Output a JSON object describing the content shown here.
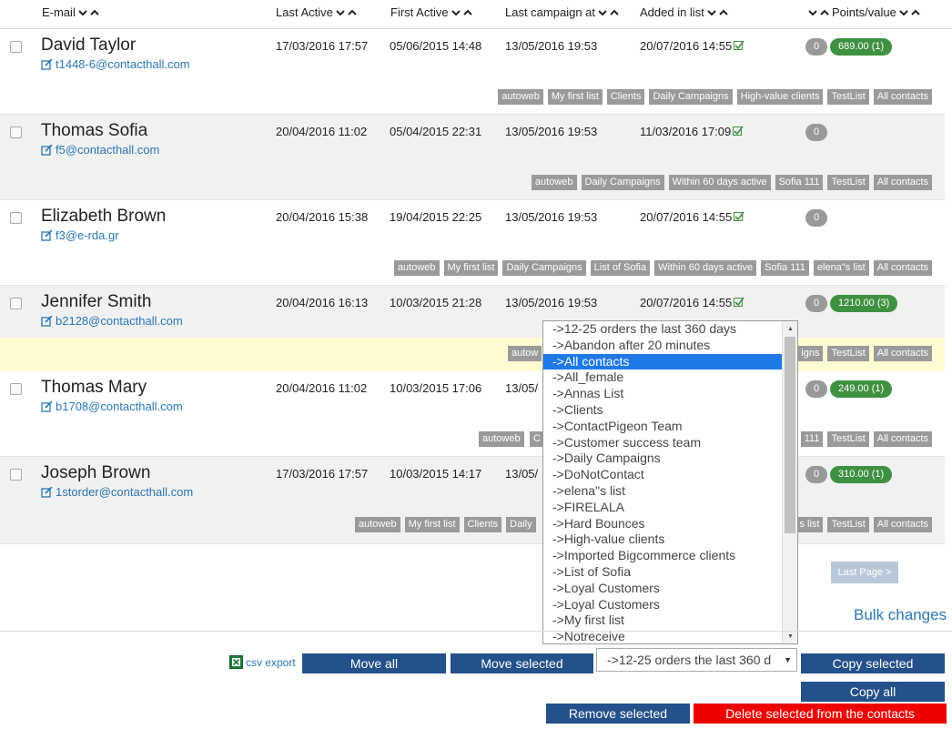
{
  "header": {
    "email": "E-mail",
    "last_active": "Last Active",
    "first_active": "First Active",
    "last_campaign": "Last campaign at",
    "added": "Added in list",
    "points": "Points/value"
  },
  "rows": [
    {
      "name": "David Taylor",
      "email": "t1448-6@contacthall.com",
      "last_active": "17/03/2016 17:57",
      "first_active": "05/06/2015 14:48",
      "last_campaign": "13/05/2016 19:53",
      "added": "20/07/2016 14:55",
      "points": "0",
      "value": "689.00 (1)",
      "tags": [
        "autoweb",
        "My first list",
        "Clients",
        "Daily Campaigns",
        "High-value clients",
        "TestList",
        "All contacts"
      ]
    },
    {
      "name": "Thomas Sofia",
      "email": "f5@contacthall.com",
      "last_active": "20/04/2016 11:02",
      "first_active": "05/04/2015 22:31",
      "last_campaign": "13/05/2016 19:53",
      "added": "11/03/2016 17:09",
      "points": "0",
      "value": "",
      "tags": [
        "autoweb",
        "Daily Campaigns",
        "Within 60 days active",
        "Sofia 111",
        "TestList",
        "All contacts"
      ]
    },
    {
      "name": "Elizabeth Brown",
      "email": "f3@e-rda.gr",
      "last_active": "20/04/2016 15:38",
      "first_active": "19/04/2015 22:25",
      "last_campaign": "13/05/2016 19:53",
      "added": "20/07/2016 14:55",
      "points": "0",
      "value": "",
      "tags": [
        "autoweb",
        "My first list",
        "Daily Campaigns",
        "List of Sofia",
        "Within 60 days active",
        "Sofia 111",
        "elena\"s list",
        "All contacts"
      ]
    },
    {
      "name": "Jennifer Smith",
      "email": "b2128@contacthall.com",
      "last_active": "20/04/2016 16:13",
      "first_active": "10/03/2015 21:28",
      "last_campaign": "13/05/2016 19:53",
      "added": "20/07/2016 14:55",
      "points": "0",
      "value": "1210.00 (3)",
      "tags": [
        "autow",
        "igns",
        "TestList",
        "All contacts"
      ]
    },
    {
      "name": "Thomas Mary",
      "email": "b1708@contacthall.com",
      "last_active": "20/04/2016 11:02",
      "first_active": "10/03/2015 17:06",
      "last_campaign": "13/05/",
      "added": "",
      "points": "0",
      "value": "249.00 (1)",
      "tags": [
        "autoweb",
        "C",
        "111",
        "TestList",
        "All contacts"
      ]
    },
    {
      "name": "Joseph Brown",
      "email": "1storder@contacthall.com",
      "last_active": "17/03/2016 17:57",
      "first_active": "10/03/2015 14:17",
      "last_campaign": "13/05/",
      "added": "",
      "points": "0",
      "value": "310.00 (1)",
      "tags": [
        "autoweb",
        "My first list",
        "Clients",
        "Daily",
        "s list",
        "TestList",
        "All contacts"
      ]
    }
  ],
  "dropdown": {
    "options": [
      "->12-25 orders the last 360 days",
      "->Abandon after 20 minutes",
      "->All contacts",
      "->All_female",
      "->Annas List",
      "->Clients",
      "->ContactPigeon Team",
      "->Customer success team",
      "->Daily Campaigns",
      "->DoNotContact",
      "->elena\"s list",
      "->FIRELALA",
      "->Hard Bounces",
      "->High-value clients",
      "->Imported Bigcommerce clients",
      "->List of Sofia",
      "->Loyal Customers",
      "->Loyal Customers",
      "->My first list",
      "->Notreceive"
    ],
    "selected_index": 2
  },
  "pagination": {
    "last_page": "Last Page >"
  },
  "bulk": {
    "title": "Bulk changes",
    "csv_export": "csv export",
    "move_all": "Move all",
    "move_selected": "Move selected",
    "select_value": "->12-25 orders the last 360 d",
    "copy_selected": "Copy selected",
    "copy_all": "Copy all",
    "remove_selected": "Remove selected",
    "delete_selected": "Delete selected from the contacts"
  },
  "colors": {
    "link": "#2a76b6",
    "tag": "#9a9a9a",
    "value_pill": "#3f9142",
    "button": "#24508b",
    "danger": "#ee0000",
    "highlight": "#1e79e8"
  }
}
